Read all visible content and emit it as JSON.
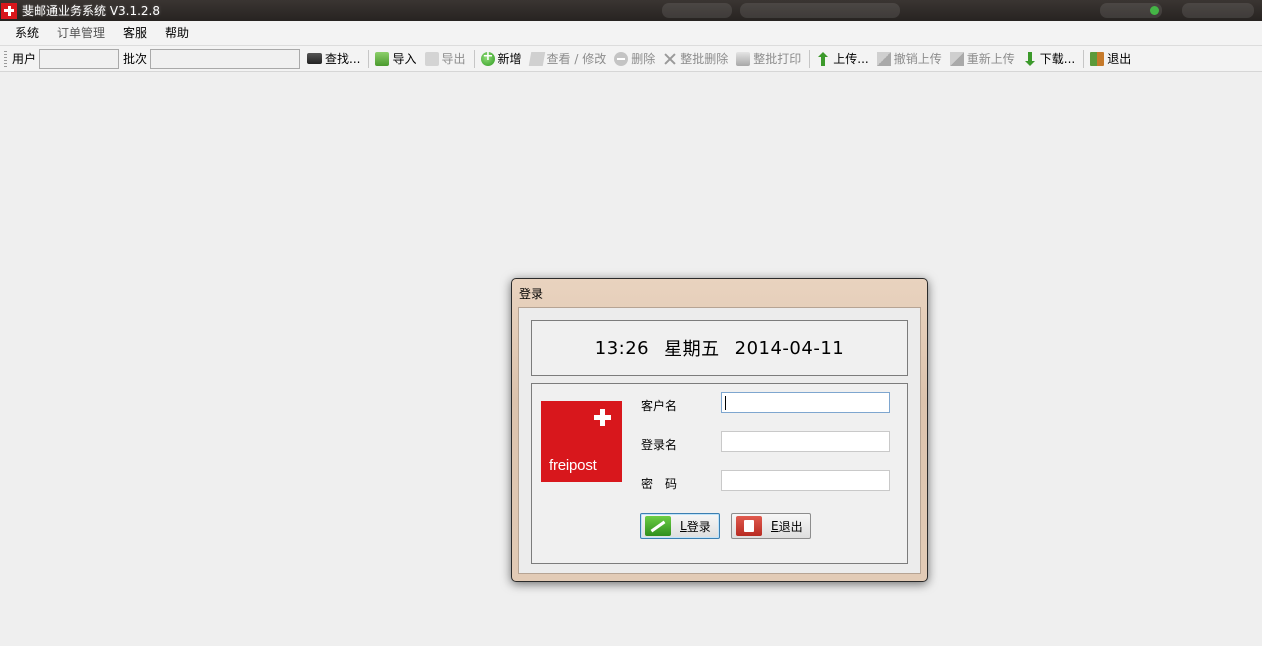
{
  "window": {
    "title": "斐邮通业务系统 V3.1.2.8"
  },
  "menu": [
    {
      "label": "系统"
    },
    {
      "label": "订单管理"
    },
    {
      "label": "客服"
    },
    {
      "label": "帮助"
    }
  ],
  "toolbar": {
    "user_label": "用户",
    "user_value": "",
    "batch_label": "批次",
    "batch_value": "",
    "find": "查找...",
    "import": "导入",
    "export": "导出",
    "add": "新增",
    "view_edit": "查看 / 修改",
    "delete": "删除",
    "batch_delete": "整批删除",
    "batch_print": "整批打印",
    "upload": "上传...",
    "cancel_upload": "撤销上传",
    "reupload": "重新上传",
    "download": "下载...",
    "exit": "退出"
  },
  "dialog": {
    "title": "登录",
    "clock": {
      "time": "13:26",
      "weekday": "星期五",
      "date": "2014-04-11"
    },
    "logo_text": "freipost",
    "fields": {
      "customer_label": "客户名",
      "customer_value": "",
      "login_label": "登录名",
      "login_value": "",
      "password_label": "密　码",
      "password_value": ""
    },
    "buttons": {
      "login_key": "L",
      "login_label": "登录",
      "exit_key": "E",
      "exit_label": "退出"
    }
  },
  "colors": {
    "brand_red": "#d8171c",
    "dialog_frame": "#e2cbb6",
    "focus_border": "#3c7fb1"
  }
}
